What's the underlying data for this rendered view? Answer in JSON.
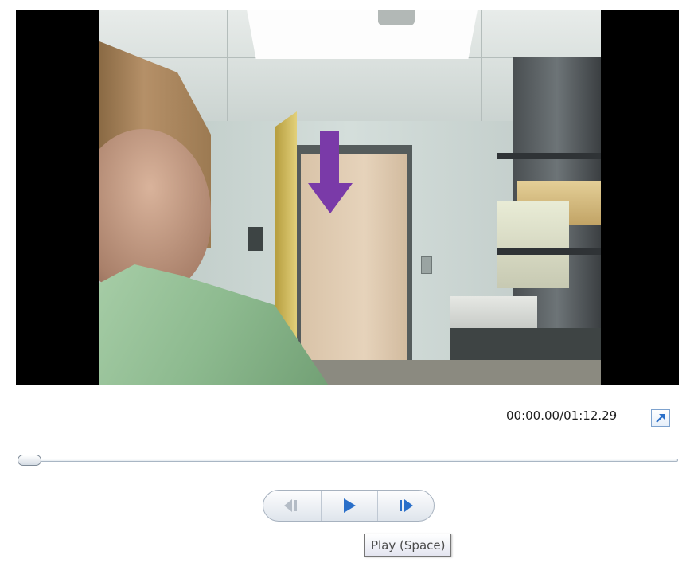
{
  "player": {
    "time_display": "00:00.00/01:12.29",
    "expand_icon": "expand-arrow-icon",
    "seek_progress": 0.0
  },
  "transport": {
    "prev_icon": "previous-frame-icon",
    "play_icon": "play-icon",
    "next_icon": "next-frame-icon"
  },
  "tooltip": {
    "text": "Play (Space)"
  },
  "colors": {
    "accent": "#2a6fc9",
    "annotation_arrow": "#7a3aa8"
  }
}
